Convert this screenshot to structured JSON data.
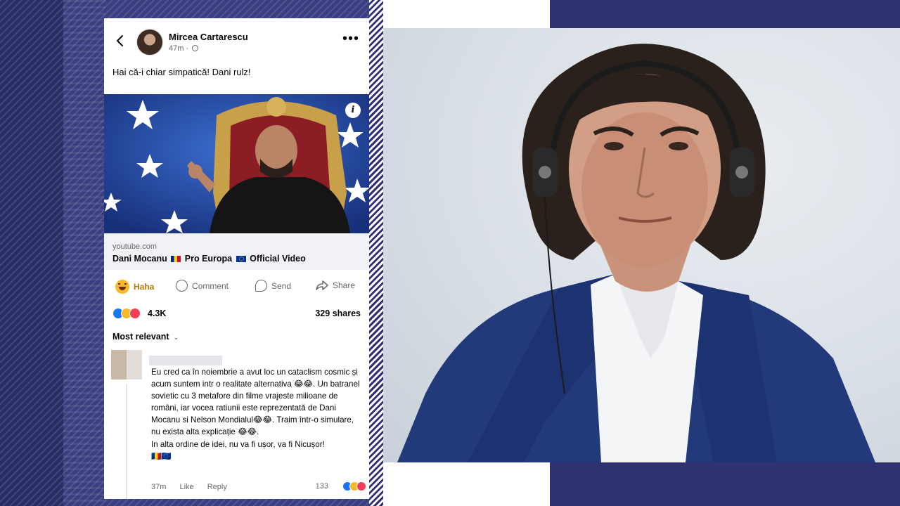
{
  "post": {
    "author": "Mircea Cartarescu",
    "time": "47m",
    "separator": "·",
    "text": "Hai că-i chiar simpatică! Dani rulz!",
    "more_label": "•••"
  },
  "link": {
    "domain": "youtube.com",
    "title_part1": "Dani Mocanu",
    "title_part2": "Pro Europa",
    "title_part3": "Official Video",
    "info_label": "i"
  },
  "actions": {
    "haha": "Haha",
    "comment": "Comment",
    "send": "Send",
    "share": "Share"
  },
  "stats": {
    "reactions": "4.3K",
    "shares": "329 shares"
  },
  "comments": {
    "sort_label": "Most relevant",
    "chevron": "⌄",
    "items": [
      {
        "text": "Eu cred ca în noiembrie a avut loc un cataclism cosmic și acum suntem intr o realitate alternativa 😂😂. Un batranel sovietic cu 3 metafore din filme vrajeste milioane de români, iar vocea ratiunii este reprezentată de Dani Mocanu si Nelson Mondialul😂😂. Traim într-o simulare, nu exista alta explicație 😂😂.\nIn alta ordine de idei, nu va fi ușor, va fi Nicușor!\n🇷🇴🇪🇺",
        "time": "37m",
        "like": "Like",
        "reply": "Reply",
        "reactions": "133"
      }
    ]
  },
  "colors": {
    "background": "#2f3170",
    "facebook_blue": "#1877f2",
    "haha_yellow": "#f7b928",
    "love_red": "#f33e58"
  },
  "icons": [
    "back-arrow-icon",
    "globe-icon",
    "more-icon",
    "info-icon",
    "haha-emoji-icon",
    "comment-icon",
    "send-icon",
    "share-icon",
    "like-reaction-icon",
    "love-reaction-icon"
  ]
}
